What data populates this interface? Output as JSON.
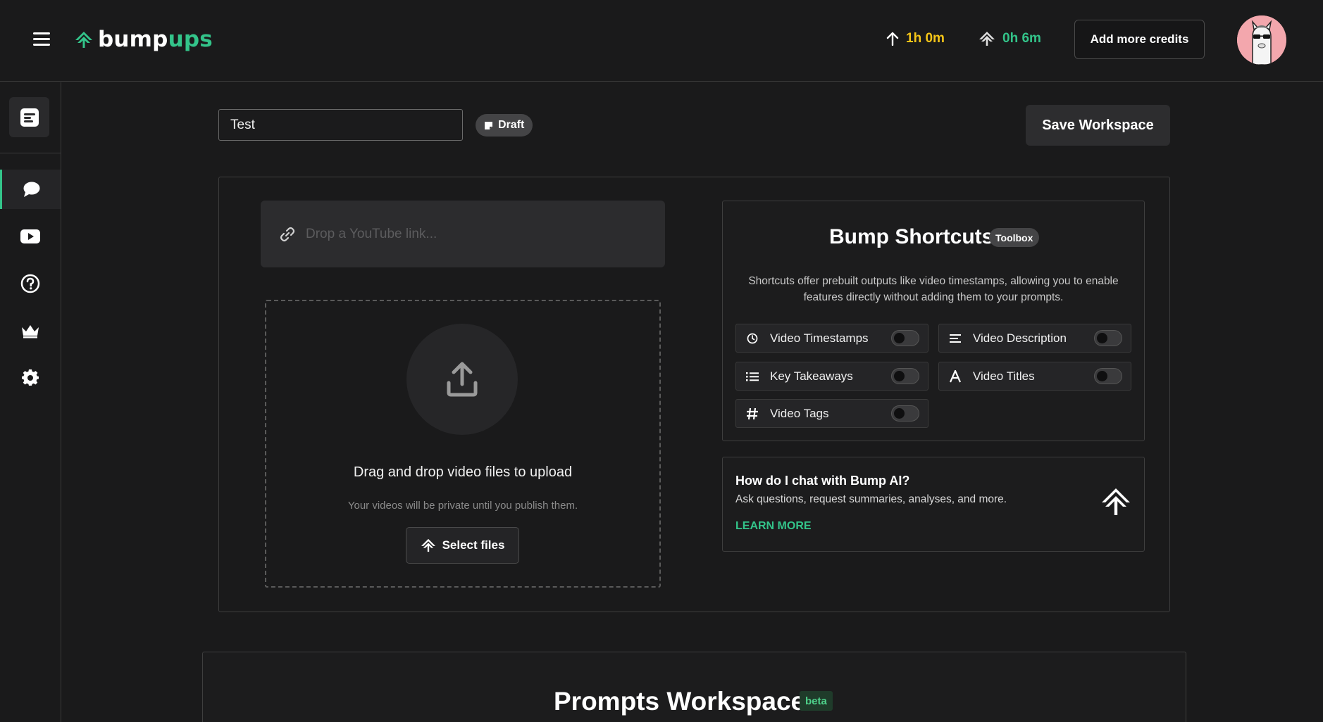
{
  "brand": {
    "part1": "bump",
    "part2": "ups",
    "accent": "#33c48a"
  },
  "header": {
    "upload_credit": "1h 0m",
    "bump_credit": "0h 6m",
    "add_credits_label": "Add more credits",
    "upload_color": "#f5c518"
  },
  "sidebar": {
    "items": [
      {
        "icon": "workspace-icon"
      },
      {
        "icon": "chat-icon",
        "active": true
      },
      {
        "icon": "youtube-icon"
      },
      {
        "icon": "help-icon"
      },
      {
        "icon": "crown-icon"
      },
      {
        "icon": "gear-icon"
      }
    ]
  },
  "workspace": {
    "name_value": "Test",
    "status": "Draft",
    "save_label": "Save Workspace"
  },
  "upload": {
    "link_placeholder": "Drop a YouTube link...",
    "drop_title": "Drag and drop video files to upload",
    "drop_subtitle": "Your videos will be private until you publish them.",
    "select_files_label": "Select files"
  },
  "shortcuts": {
    "title": "Bump Shortcuts",
    "badge": "Toolbox",
    "description": "Shortcuts offer prebuilt outputs like video timestamps, allowing you to enable features directly without adding them to your prompts.",
    "toggles": [
      {
        "label": "Video Timestamps",
        "icon": "clock-icon",
        "on": false
      },
      {
        "label": "Video Description",
        "icon": "lines-icon",
        "on": false
      },
      {
        "label": "Key Takeaways",
        "icon": "list-icon",
        "on": false
      },
      {
        "label": "Video Titles",
        "icon": "letter-a-icon",
        "on": false
      },
      {
        "label": "Video Tags",
        "icon": "hash-icon",
        "on": false
      }
    ]
  },
  "chat_help": {
    "title": "How do I chat with Bump AI?",
    "description": "Ask questions, request summaries, analyses, and more.",
    "link": "LEARN MORE"
  },
  "prompts": {
    "title": "Prompts Workspace",
    "badge": "beta"
  }
}
